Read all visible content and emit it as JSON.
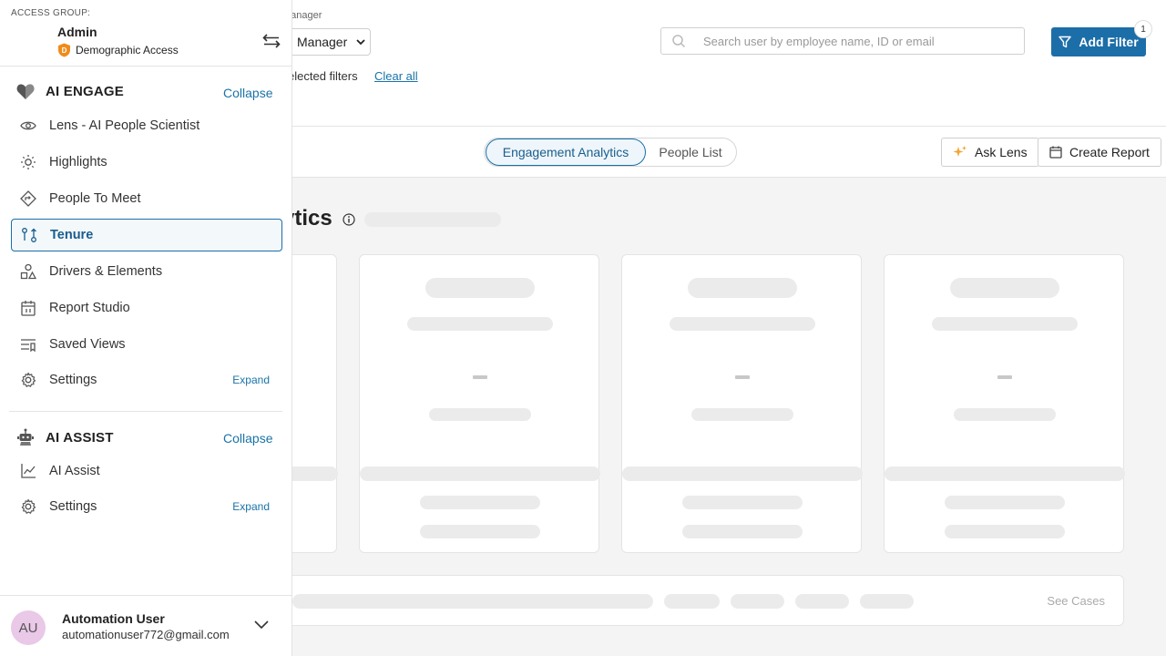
{
  "header": {
    "manager_label": "Manager",
    "manager_value": "Manager",
    "selected_filters_text": "elected filters",
    "clear_all": "Clear all",
    "search_placeholder": "Search user by employee name, ID or email",
    "add_filter": "Add Filter",
    "filter_badge": "1"
  },
  "tabs": [
    {
      "label": "Engagement Analytics",
      "active": true
    },
    {
      "label": "People List",
      "active": false
    }
  ],
  "actions": {
    "ask_lens": "Ask Lens",
    "create_report": "Create Report"
  },
  "main": {
    "heading": "ytics",
    "card_value": "–",
    "see_cases": "See Cases"
  },
  "sidebar": {
    "access_group_label": "ACCESS GROUP:",
    "access_name": "Admin",
    "access_sub": "Demographic Access",
    "sections": [
      {
        "title": "AI ENGAGE",
        "collapse": "Collapse",
        "items": [
          {
            "label": "Lens - AI People Scientist",
            "icon": "eye-icon"
          },
          {
            "label": "Highlights",
            "icon": "sun-icon"
          },
          {
            "label": "People To Meet",
            "icon": "diamond-arrow-icon"
          },
          {
            "label": "Tenure",
            "icon": "tenure-icon",
            "active": true
          },
          {
            "label": "Drivers & Elements",
            "icon": "shapes-icon"
          },
          {
            "label": "Report Studio",
            "icon": "calendar-icon"
          },
          {
            "label": "Saved Views",
            "icon": "saved-views-icon"
          },
          {
            "label": "Settings",
            "icon": "gear-icon",
            "expand": "Expand"
          }
        ]
      },
      {
        "title": "AI ASSIST",
        "collapse": "Collapse",
        "items": [
          {
            "label": "AI Assist",
            "icon": "chart-line-icon"
          },
          {
            "label": "Settings",
            "icon": "gear-icon",
            "expand": "Expand"
          }
        ]
      }
    ],
    "user": {
      "initials": "AU",
      "name": "Automation User",
      "email": "automationuser772@gmail.com"
    }
  },
  "colors": {
    "accent": "#1c6ea8",
    "link": "#1a73a8",
    "skeleton": "#ebebeb",
    "avatar_bg": "#e9c8e8",
    "shield": "#f08c1a"
  }
}
